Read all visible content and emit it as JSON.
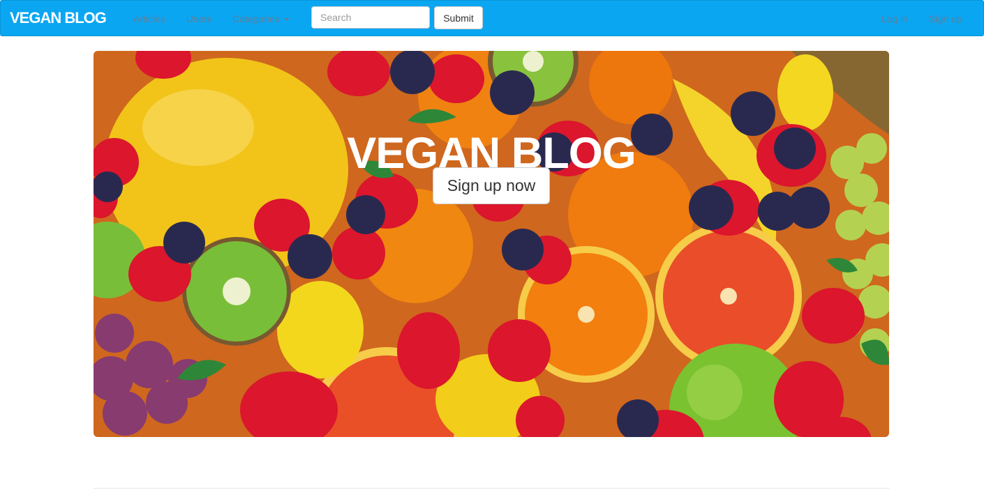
{
  "navbar": {
    "brand": "VEGAN BLOG",
    "links": [
      "Articles",
      "Users"
    ],
    "categories_label": "Categories",
    "search_placeholder": "Search",
    "submit_label": "Submit",
    "login_label": "Log in",
    "signup_label": "Sign up",
    "background_color": "#0aa6f2",
    "link_color": "#5f7f99"
  },
  "hero": {
    "title": "VEGAN BLOG",
    "button_label": "Sign up now",
    "image_subject": "fresh-fruit-photo"
  }
}
